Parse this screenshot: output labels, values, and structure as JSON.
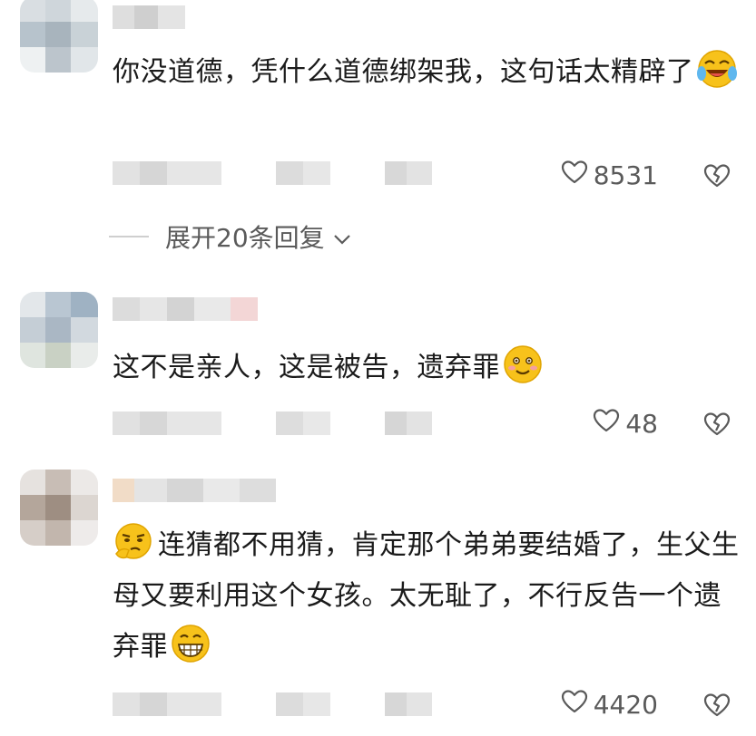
{
  "comments": [
    {
      "text": "你没道德，凭什么道德绑架我，这句话太精辟了",
      "emoji": "laughing-tears-emoji",
      "likes": "8531"
    },
    {
      "text": "这不是亲人，这是被告，遗弃罪",
      "emoji": "smile-emoji",
      "likes": "48"
    },
    {
      "text": "连猜都不用猜，肯定那个弟弟要结婚了，生父生母又要利用这个女孩。太无耻了，不行反告一个遗弃罪",
      "emoji_start": "thinking-smirk-emoji",
      "emoji": "grin-emoji",
      "likes": "4420"
    }
  ],
  "expand_replies": "展开20条回复",
  "icons": {
    "like": "heart-outline-icon",
    "dislike": "broken-heart-icon",
    "expand": "chevron-down-icon"
  },
  "colors": {
    "text": "#1b1b1b",
    "meta": "#5a5a5a",
    "emoji_yellow": "#f7c21b"
  }
}
